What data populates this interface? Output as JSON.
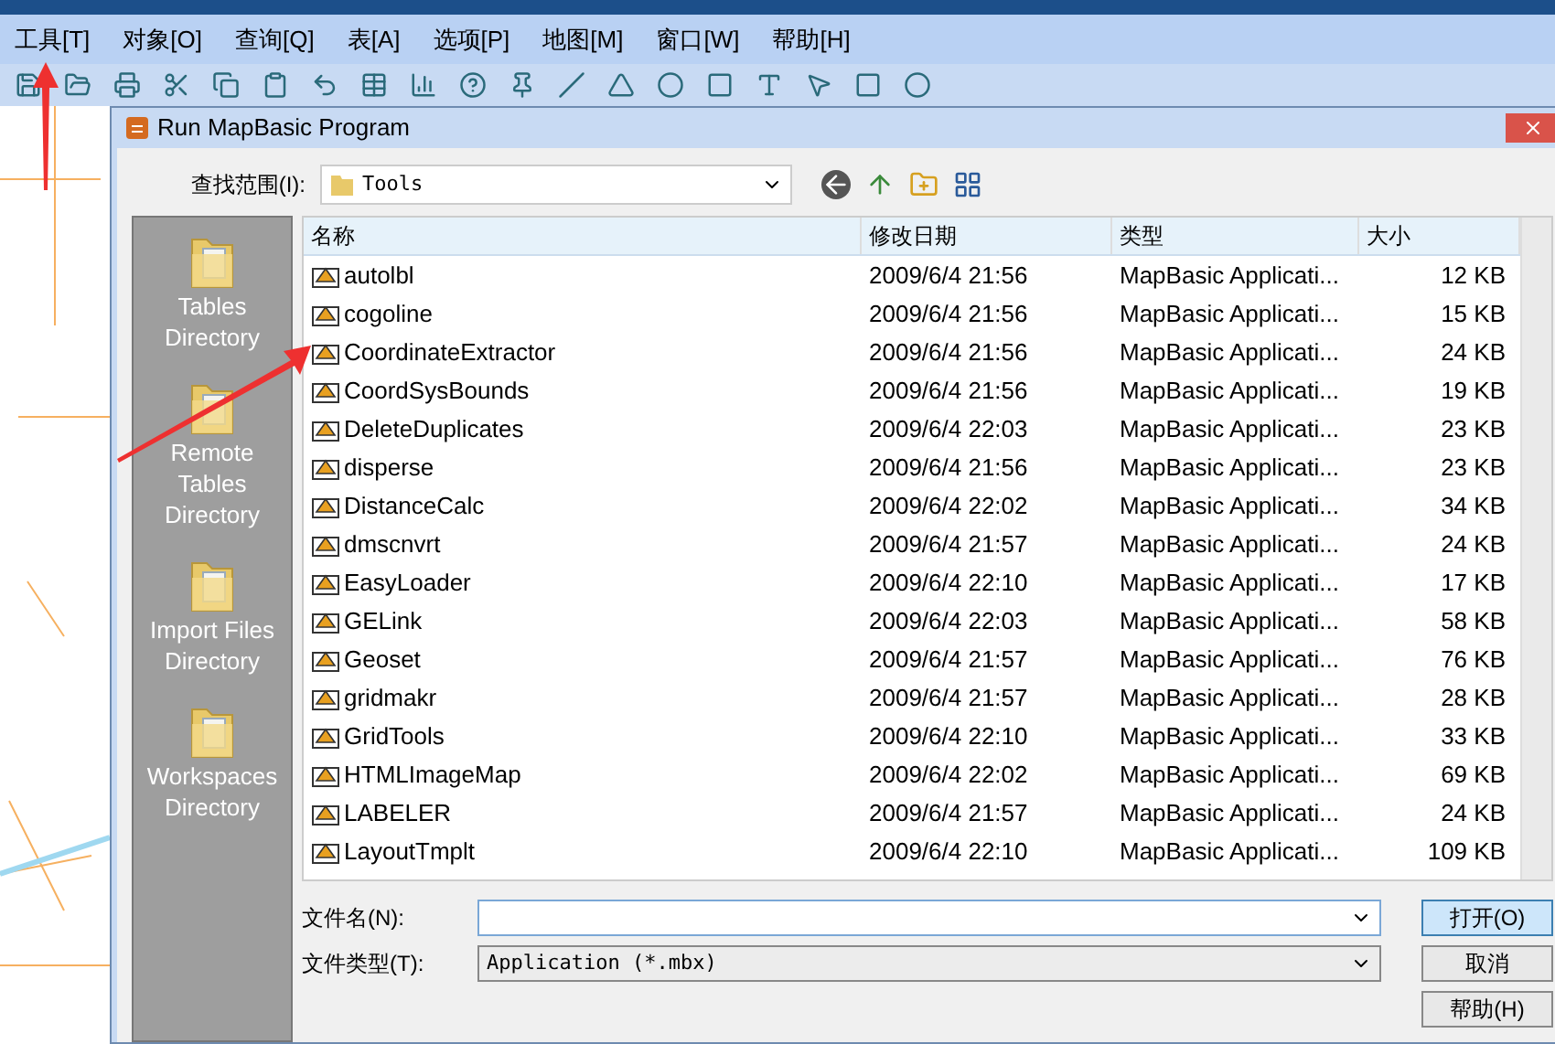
{
  "menu_bar": [
    {
      "label": "工具[T]"
    },
    {
      "label": "对象[O]"
    },
    {
      "label": "查询[Q]"
    },
    {
      "label": "表[A]"
    },
    {
      "label": "选项[P]"
    },
    {
      "label": "地图[M]"
    },
    {
      "label": "窗口[W]"
    },
    {
      "label": "帮助[H]"
    }
  ],
  "dialog": {
    "title": "Run MapBasic Program",
    "look_in": {
      "label": "查找范围(I):",
      "value": "Tools"
    },
    "places": [
      {
        "label": "Tables Directory"
      },
      {
        "label": "Remote Tables Directory"
      },
      {
        "label": "Import Files Directory"
      },
      {
        "label": "Workspaces Directory"
      }
    ],
    "table": {
      "columns": [
        "名称",
        "修改日期",
        "类型",
        "大小"
      ],
      "rows": [
        [
          "autolbl",
          "2009/6/4 21:56",
          "MapBasic Applicati...",
          "12 KB"
        ],
        [
          "cogoline",
          "2009/6/4 21:56",
          "MapBasic Applicati...",
          "15 KB"
        ],
        [
          "CoordinateExtractor",
          "2009/6/4 21:56",
          "MapBasic Applicati...",
          "24 KB"
        ],
        [
          "CoordSysBounds",
          "2009/6/4 21:56",
          "MapBasic Applicati...",
          "19 KB"
        ],
        [
          "DeleteDuplicates",
          "2009/6/4 22:03",
          "MapBasic Applicati...",
          "23 KB"
        ],
        [
          "disperse",
          "2009/6/4 21:56",
          "MapBasic Applicati...",
          "23 KB"
        ],
        [
          "DistanceCalc",
          "2009/6/4 22:02",
          "MapBasic Applicati...",
          "34 KB"
        ],
        [
          "dmscnvrt",
          "2009/6/4 21:57",
          "MapBasic Applicati...",
          "24 KB"
        ],
        [
          "EasyLoader",
          "2009/6/4 22:10",
          "MapBasic Applicati...",
          "17 KB"
        ],
        [
          "GELink",
          "2009/6/4 22:03",
          "MapBasic Applicati...",
          "58 KB"
        ],
        [
          "Geoset",
          "2009/6/4 21:57",
          "MapBasic Applicati...",
          "76 KB"
        ],
        [
          "gridmakr",
          "2009/6/4 21:57",
          "MapBasic Applicati...",
          "28 KB"
        ],
        [
          "GridTools",
          "2009/6/4 22:10",
          "MapBasic Applicati...",
          "33 KB"
        ],
        [
          "HTMLImageMap",
          "2009/6/4 22:02",
          "MapBasic Applicati...",
          "69 KB"
        ],
        [
          "LABELER",
          "2009/6/4 21:57",
          "MapBasic Applicati...",
          "24 KB"
        ],
        [
          "LayoutTmplt",
          "2009/6/4 22:10",
          "MapBasic Applicati...",
          "109 KB"
        ]
      ]
    },
    "file_name": {
      "label": "文件名(N):"
    },
    "file_type": {
      "label": "文件类型(T):",
      "value": "Application (*.mbx)"
    },
    "buttons": [
      {
        "label": "打开(O)",
        "selected": true
      },
      {
        "label": "取消",
        "selected": false
      },
      {
        "label": "帮助(H)",
        "selected": false
      }
    ]
  }
}
